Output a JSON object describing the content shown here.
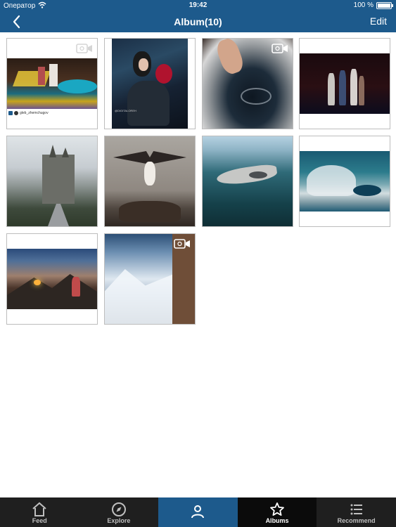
{
  "status_bar": {
    "carrier": "Оператор",
    "time": "19:42",
    "battery": "100 %"
  },
  "nav": {
    "title": "Album(10)",
    "edit_label": "Edit",
    "back_icon": "chevron-left-icon"
  },
  "album_items": [
    {
      "subject": "night party by pool",
      "caption": "gleb_zhemchugov",
      "video": true
    },
    {
      "subject": "woman with red flowers",
      "caption": "@DIGITALOREH",
      "video": false
    },
    {
      "subject": "person in bath water",
      "caption": "",
      "video": true
    },
    {
      "subject": "couple at night",
      "caption": "",
      "video": false
    },
    {
      "subject": "castle in fog",
      "caption": "",
      "video": false
    },
    {
      "subject": "osprey landing on nest",
      "caption": "",
      "video": false
    },
    {
      "subject": "shark underwater",
      "caption": "",
      "video": false
    },
    {
      "subject": "ocean wave",
      "caption": "",
      "video": false
    },
    {
      "subject": "mountain campfire",
      "caption": "",
      "video": false
    },
    {
      "subject": "snowy mountains",
      "caption": "",
      "video": true
    }
  ],
  "tabs": [
    {
      "label": "Feed",
      "icon": "home-icon"
    },
    {
      "label": "Explore",
      "icon": "compass-icon"
    },
    {
      "label": "",
      "icon": "person-icon"
    },
    {
      "label": "Albums",
      "icon": "star-icon"
    },
    {
      "label": "Recommend",
      "icon": "list-icon"
    }
  ],
  "colors": {
    "header": "#1d5a8c",
    "tabbar": "#1f1f1f",
    "tab_active": "#0b0b0b"
  }
}
